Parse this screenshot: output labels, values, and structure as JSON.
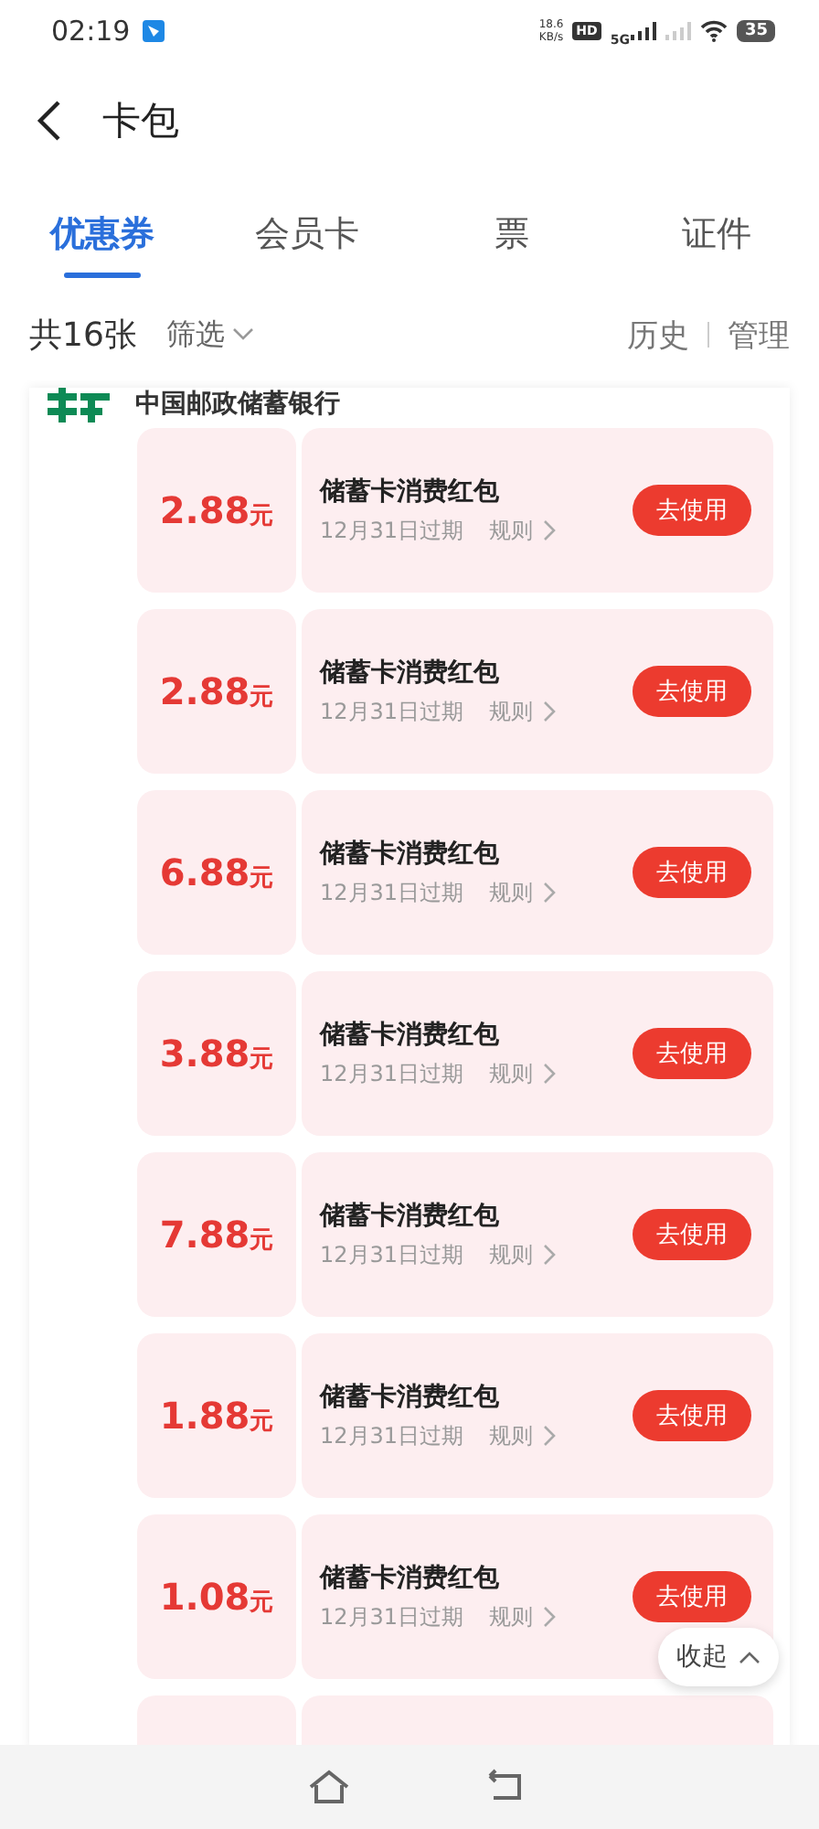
{
  "status_bar": {
    "time": "02:19",
    "speed": "18.6",
    "speed_unit": "KB/s",
    "hd": "HD",
    "network": "5G",
    "battery": "35"
  },
  "header": {
    "title": "卡包"
  },
  "tabs": [
    {
      "label": "优惠券",
      "selected": true
    },
    {
      "label": "会员卡",
      "selected": false
    },
    {
      "label": "票",
      "selected": false
    },
    {
      "label": "证件",
      "selected": false
    }
  ],
  "toolbar": {
    "count": "共16张",
    "filter": "筛选",
    "history": "历史",
    "manage": "管理"
  },
  "bank": {
    "name": "中国邮政储蓄银行"
  },
  "coupons": [
    {
      "kind": "full",
      "amount": "2.88",
      "unit": "元",
      "title": "储蓄卡消费红包",
      "expiry": "12月31日过期",
      "rule": "规则",
      "button": "去使用"
    },
    {
      "kind": "full",
      "amount": "2.88",
      "unit": "元",
      "title": "储蓄卡消费红包",
      "expiry": "12月31日过期",
      "rule": "规则",
      "button": "去使用"
    },
    {
      "kind": "full",
      "amount": "6.88",
      "unit": "元",
      "title": "储蓄卡消费红包",
      "expiry": "12月31日过期",
      "rule": "规则",
      "button": "去使用"
    },
    {
      "kind": "full",
      "amount": "3.88",
      "unit": "元",
      "title": "储蓄卡消费红包",
      "expiry": "12月31日过期",
      "rule": "规则",
      "button": "去使用"
    },
    {
      "kind": "full",
      "amount": "7.88",
      "unit": "元",
      "title": "储蓄卡消费红包",
      "expiry": "12月31日过期",
      "rule": "规则",
      "button": "去使用"
    },
    {
      "kind": "full",
      "amount": "1.88",
      "unit": "元",
      "title": "储蓄卡消费红包",
      "expiry": "12月31日过期",
      "rule": "规则",
      "button": "去使用"
    },
    {
      "kind": "full",
      "amount": "1.08",
      "unit": "元",
      "title": "储蓄卡消费红包",
      "expiry": "12月31日过期",
      "rule": "规则",
      "button": "去使用"
    },
    {
      "kind": "partial"
    }
  ],
  "collapse_button": {
    "label": "收起"
  }
}
